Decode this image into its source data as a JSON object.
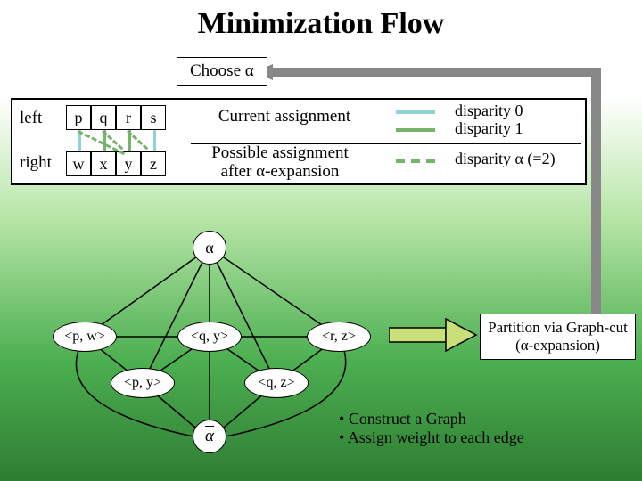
{
  "title": "Minimization Flow",
  "choose": "Choose α",
  "row_left": "left",
  "row_right": "right",
  "cells_top": [
    "p",
    "q",
    "r",
    "s"
  ],
  "cells_bot": [
    "w",
    "x",
    "y",
    "z"
  ],
  "current": "Current assignment",
  "possible_l1": "Possible assignment",
  "possible_l2": "after α-expansion",
  "disp0": "disparity 0",
  "disp1": "disparity 1",
  "dispA": "disparity α (=2)",
  "alpha": "α",
  "n_pw": "<p, w>",
  "n_qy": "<q, y>",
  "n_rz": "<r, z>",
  "n_py": "<p, y>",
  "n_qz": "<q, z>",
  "alpha_bar": "α",
  "partition_l1": "Partition via Graph-cut",
  "partition_l2": "(α-expansion)",
  "bullet1": "Construct a Graph",
  "bullet2": "Assign weight to each edge"
}
